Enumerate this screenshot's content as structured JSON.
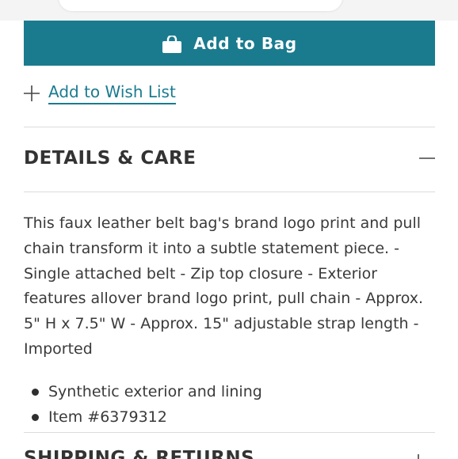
{
  "primary_action": {
    "label": "Add to Bag",
    "icon": "shopping-bag-icon",
    "color": "#1a7b8f"
  },
  "wishlist": {
    "label": "Add to Wish List",
    "icon": "plus-icon"
  },
  "details_section": {
    "title": "DETAILS & CARE",
    "toggle_icon": "minus-icon",
    "description": "This faux leather belt bag's brand logo print and pull chain transform it into a subtle statement piece. - Single attached belt - Zip top closure - Exterior features allover brand logo print, pull chain - Approx. 5\" H x 7.5\" W - Approx. 15\" adjustable strap length - Imported",
    "bullets": [
      "Synthetic exterior and lining",
      "Item #6379312"
    ]
  },
  "next_section": {
    "title": "SHIPPING & RETURNS",
    "toggle_icon": "plus-icon"
  }
}
